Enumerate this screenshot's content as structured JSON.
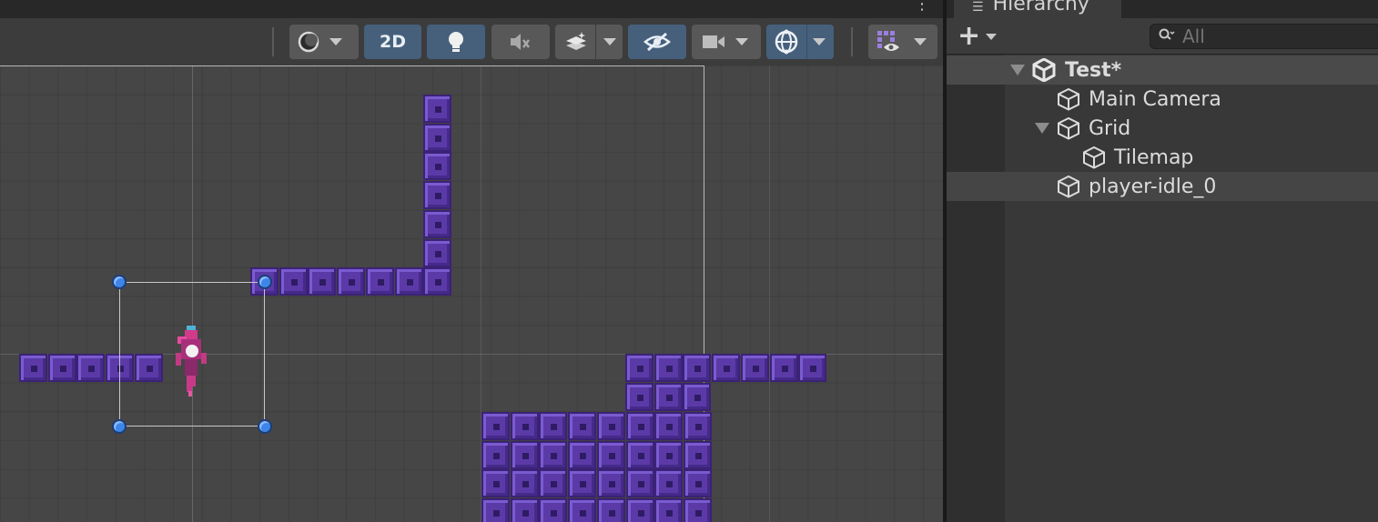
{
  "scene_toolbar": {
    "mode_2d_label": "2D",
    "colors": {
      "toggle_on": "#46607c",
      "toggle_off": "#585858"
    }
  },
  "hierarchy": {
    "tab_label": "Hierarchy",
    "search_placeholder": "All",
    "rows": [
      {
        "name": "Test*",
        "icon": "unity-scene-icon",
        "expanded": true
      },
      {
        "name": "Main Camera",
        "icon": "gameobject-cube-icon"
      },
      {
        "name": "Grid",
        "icon": "gameobject-cube-icon",
        "expanded": true
      },
      {
        "name": "Tilemap",
        "icon": "gameobject-cube-icon"
      },
      {
        "name": "player-idle_0",
        "icon": "gameobject-cube-icon",
        "selected": true
      }
    ]
  }
}
